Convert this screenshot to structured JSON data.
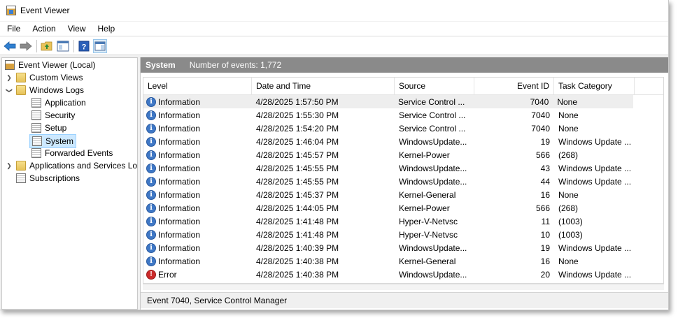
{
  "window": {
    "title": "Event Viewer",
    "app_icon": "event-viewer-icon"
  },
  "menu": [
    "File",
    "Action",
    "View",
    "Help"
  ],
  "toolbar": {
    "buttons": [
      "back-arrow-icon",
      "forward-arrow-icon",
      "up-folder-icon",
      "show-hide-tree-icon",
      "help-icon",
      "show-hide-action-pane-icon"
    ]
  },
  "tree": {
    "root": "Event Viewer (Local)",
    "custom_views": "Custom Views",
    "windows_logs": "Windows Logs",
    "application": "Application",
    "security": "Security",
    "setup": "Setup",
    "system": "System",
    "forwarded_events": "Forwarded Events",
    "apps_services": "Applications and Services Lo",
    "subscriptions": "Subscriptions"
  },
  "header": {
    "log_name": "System",
    "count_text": "Number of events: 1,772"
  },
  "columns": {
    "level": "Level",
    "date": "Date and Time",
    "source": "Source",
    "event_id": "Event ID",
    "task": "Task Category"
  },
  "events": [
    {
      "level": "Information",
      "type": "info",
      "date": "4/28/2025 1:57:50 PM",
      "source": "Service Control ...",
      "id": "7040",
      "task": "None"
    },
    {
      "level": "Information",
      "type": "info",
      "date": "4/28/2025 1:55:30 PM",
      "source": "Service Control ...",
      "id": "7040",
      "task": "None"
    },
    {
      "level": "Information",
      "type": "info",
      "date": "4/28/2025 1:54:20 PM",
      "source": "Service Control ...",
      "id": "7040",
      "task": "None"
    },
    {
      "level": "Information",
      "type": "info",
      "date": "4/28/2025 1:46:04 PM",
      "source": "WindowsUpdate...",
      "id": "19",
      "task": "Windows Update ..."
    },
    {
      "level": "Information",
      "type": "info",
      "date": "4/28/2025 1:45:57 PM",
      "source": "Kernel-Power",
      "id": "566",
      "task": "(268)"
    },
    {
      "level": "Information",
      "type": "info",
      "date": "4/28/2025 1:45:55 PM",
      "source": "WindowsUpdate...",
      "id": "43",
      "task": "Windows Update ..."
    },
    {
      "level": "Information",
      "type": "info",
      "date": "4/28/2025 1:45:55 PM",
      "source": "WindowsUpdate...",
      "id": "44",
      "task": "Windows Update ..."
    },
    {
      "level": "Information",
      "type": "info",
      "date": "4/28/2025 1:45:37 PM",
      "source": "Kernel-General",
      "id": "16",
      "task": "None"
    },
    {
      "level": "Information",
      "type": "info",
      "date": "4/28/2025 1:44:05 PM",
      "source": "Kernel-Power",
      "id": "566",
      "task": "(268)"
    },
    {
      "level": "Information",
      "type": "info",
      "date": "4/28/2025 1:41:48 PM",
      "source": "Hyper-V-Netvsc",
      "id": "11",
      "task": "(1003)"
    },
    {
      "level": "Information",
      "type": "info",
      "date": "4/28/2025 1:41:48 PM",
      "source": "Hyper-V-Netvsc",
      "id": "10",
      "task": "(1003)"
    },
    {
      "level": "Information",
      "type": "info",
      "date": "4/28/2025 1:40:39 PM",
      "source": "WindowsUpdate...",
      "id": "19",
      "task": "Windows Update ..."
    },
    {
      "level": "Information",
      "type": "info",
      "date": "4/28/2025 1:40:38 PM",
      "source": "Kernel-General",
      "id": "16",
      "task": "None"
    },
    {
      "level": "Error",
      "type": "error",
      "date": "4/28/2025 1:40:38 PM",
      "source": "WindowsUpdate...",
      "id": "20",
      "task": "Windows Update ..."
    }
  ],
  "status": "Event 7040, Service Control Manager",
  "colors": {
    "selection": "#cce8ff",
    "header_bar": "#8a8a8a",
    "info": "#3f78c6",
    "error": "#cc2a2a"
  }
}
